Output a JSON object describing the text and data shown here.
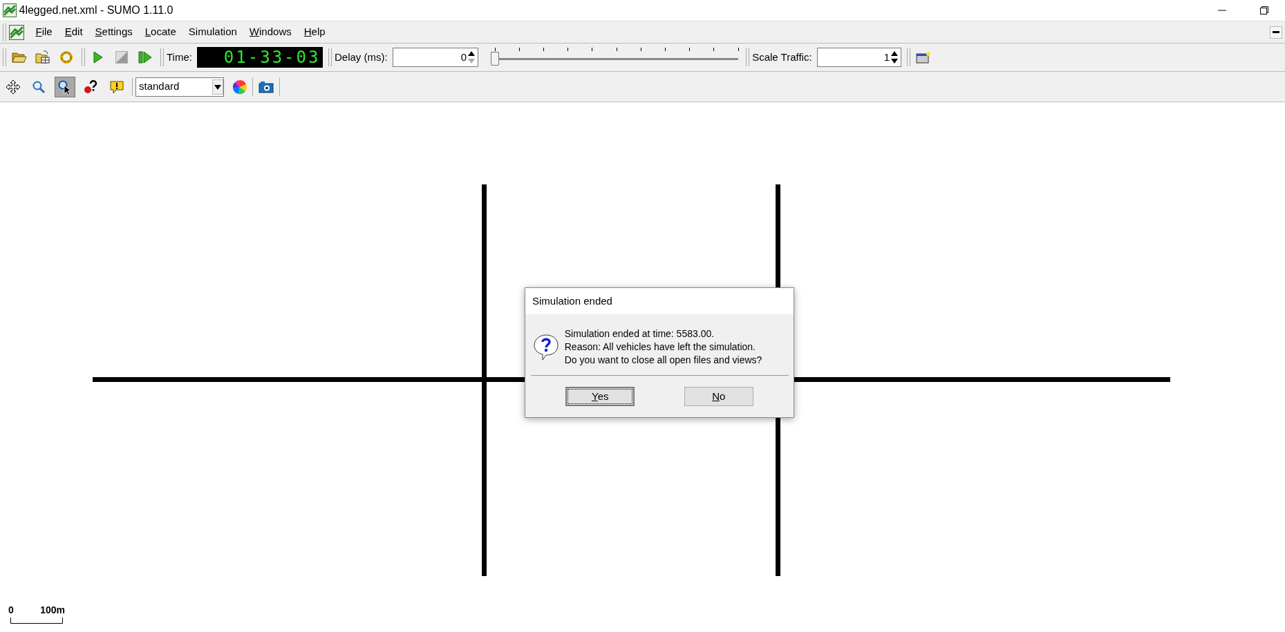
{
  "window": {
    "title": "4legged.net.xml - SUMO 1.11.0"
  },
  "menu": [
    {
      "label": "File",
      "underline_first": true
    },
    {
      "label": "Edit",
      "underline_first": true
    },
    {
      "label": "Settings",
      "underline_first": true
    },
    {
      "label": "Locate",
      "underline_first": true
    },
    {
      "label": "Simulation",
      "underline_first": false
    },
    {
      "label": "Windows",
      "underline_first": true
    },
    {
      "label": "Help",
      "underline_first": true
    }
  ],
  "toolbar": {
    "time_label": "Time:",
    "time": "01-33-03",
    "delay_label": "Delay (ms):",
    "delay": "0",
    "delay_slider": {
      "level": 0
    },
    "scale_label": "Scale Traffic:",
    "scale": "1"
  },
  "view_tools": [
    {
      "selected": false
    },
    {
      "selected": false
    },
    {
      "selected": true
    },
    {
      "selected": false
    },
    {
      "selected": false
    }
  ],
  "scheme": "standard",
  "scale_bar": {
    "start": "0",
    "end": "100m"
  },
  "dialog": {
    "title": "Simulation ended",
    "lines": [
      "Simulation ended at time: 5583.00.",
      "Reason: All vehicles have left the simulation.",
      "Do you want to close all open files and views?"
    ],
    "buttons": [
      {
        "label": "Yes",
        "focused": true,
        "underline_first": true
      },
      {
        "label": "No",
        "focused": false,
        "underline_first": true
      }
    ]
  }
}
